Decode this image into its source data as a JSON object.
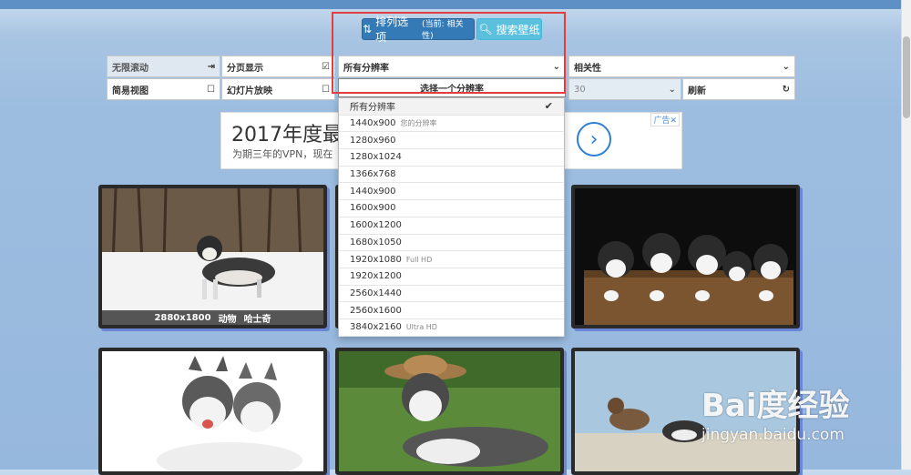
{
  "toolbar": {
    "sort_label": "排列选项",
    "sort_current": "(当前: 相关性)",
    "search_label": "搜索壁纸"
  },
  "controls": {
    "infinite_scroll": "无限滚动",
    "pagination": "分页显示",
    "resolution_selected": "所有分辨率",
    "sort_by": "相关性",
    "simple_view": "简易视图",
    "slideshow": "幻灯片放映",
    "choose_resolution": "选择一个分辨率",
    "per_page": "30",
    "refresh": "刷新"
  },
  "resolution_dropdown": {
    "options": [
      {
        "label": "所有分辨率",
        "note": "",
        "selected": true
      },
      {
        "label": "1440x900",
        "note": "您的分辨率",
        "selected": false
      },
      {
        "label": "1280x960",
        "note": "",
        "selected": false
      },
      {
        "label": "1280x1024",
        "note": "",
        "selected": false
      },
      {
        "label": "1366x768",
        "note": "",
        "selected": false
      },
      {
        "label": "1440x900",
        "note": "",
        "selected": false
      },
      {
        "label": "1600x900",
        "note": "",
        "selected": false
      },
      {
        "label": "1600x1200",
        "note": "",
        "selected": false
      },
      {
        "label": "1680x1050",
        "note": "",
        "selected": false
      },
      {
        "label": "1920x1080",
        "note": "Full HD",
        "selected": false
      },
      {
        "label": "1920x1200",
        "note": "",
        "selected": false
      },
      {
        "label": "2560x1440",
        "note": "",
        "selected": false
      },
      {
        "label": "2560x1600",
        "note": "",
        "selected": false
      },
      {
        "label": "3840x2160",
        "note": "Ultra HD",
        "selected": false
      }
    ]
  },
  "ad": {
    "title": "2017年度最",
    "desc": "为期三年的VPN，现在",
    "tag": "广告"
  },
  "cards": [
    {
      "resolution": "2880x1800",
      "tag1": "动物",
      "tag2": "哈士奇"
    }
  ],
  "watermark": {
    "main": "Bai度经验",
    "sub": "jingyan.baidu.com"
  },
  "colors": {
    "primary": "#337ab7",
    "info": "#5bc0de",
    "highlight": "#e13f3f"
  }
}
